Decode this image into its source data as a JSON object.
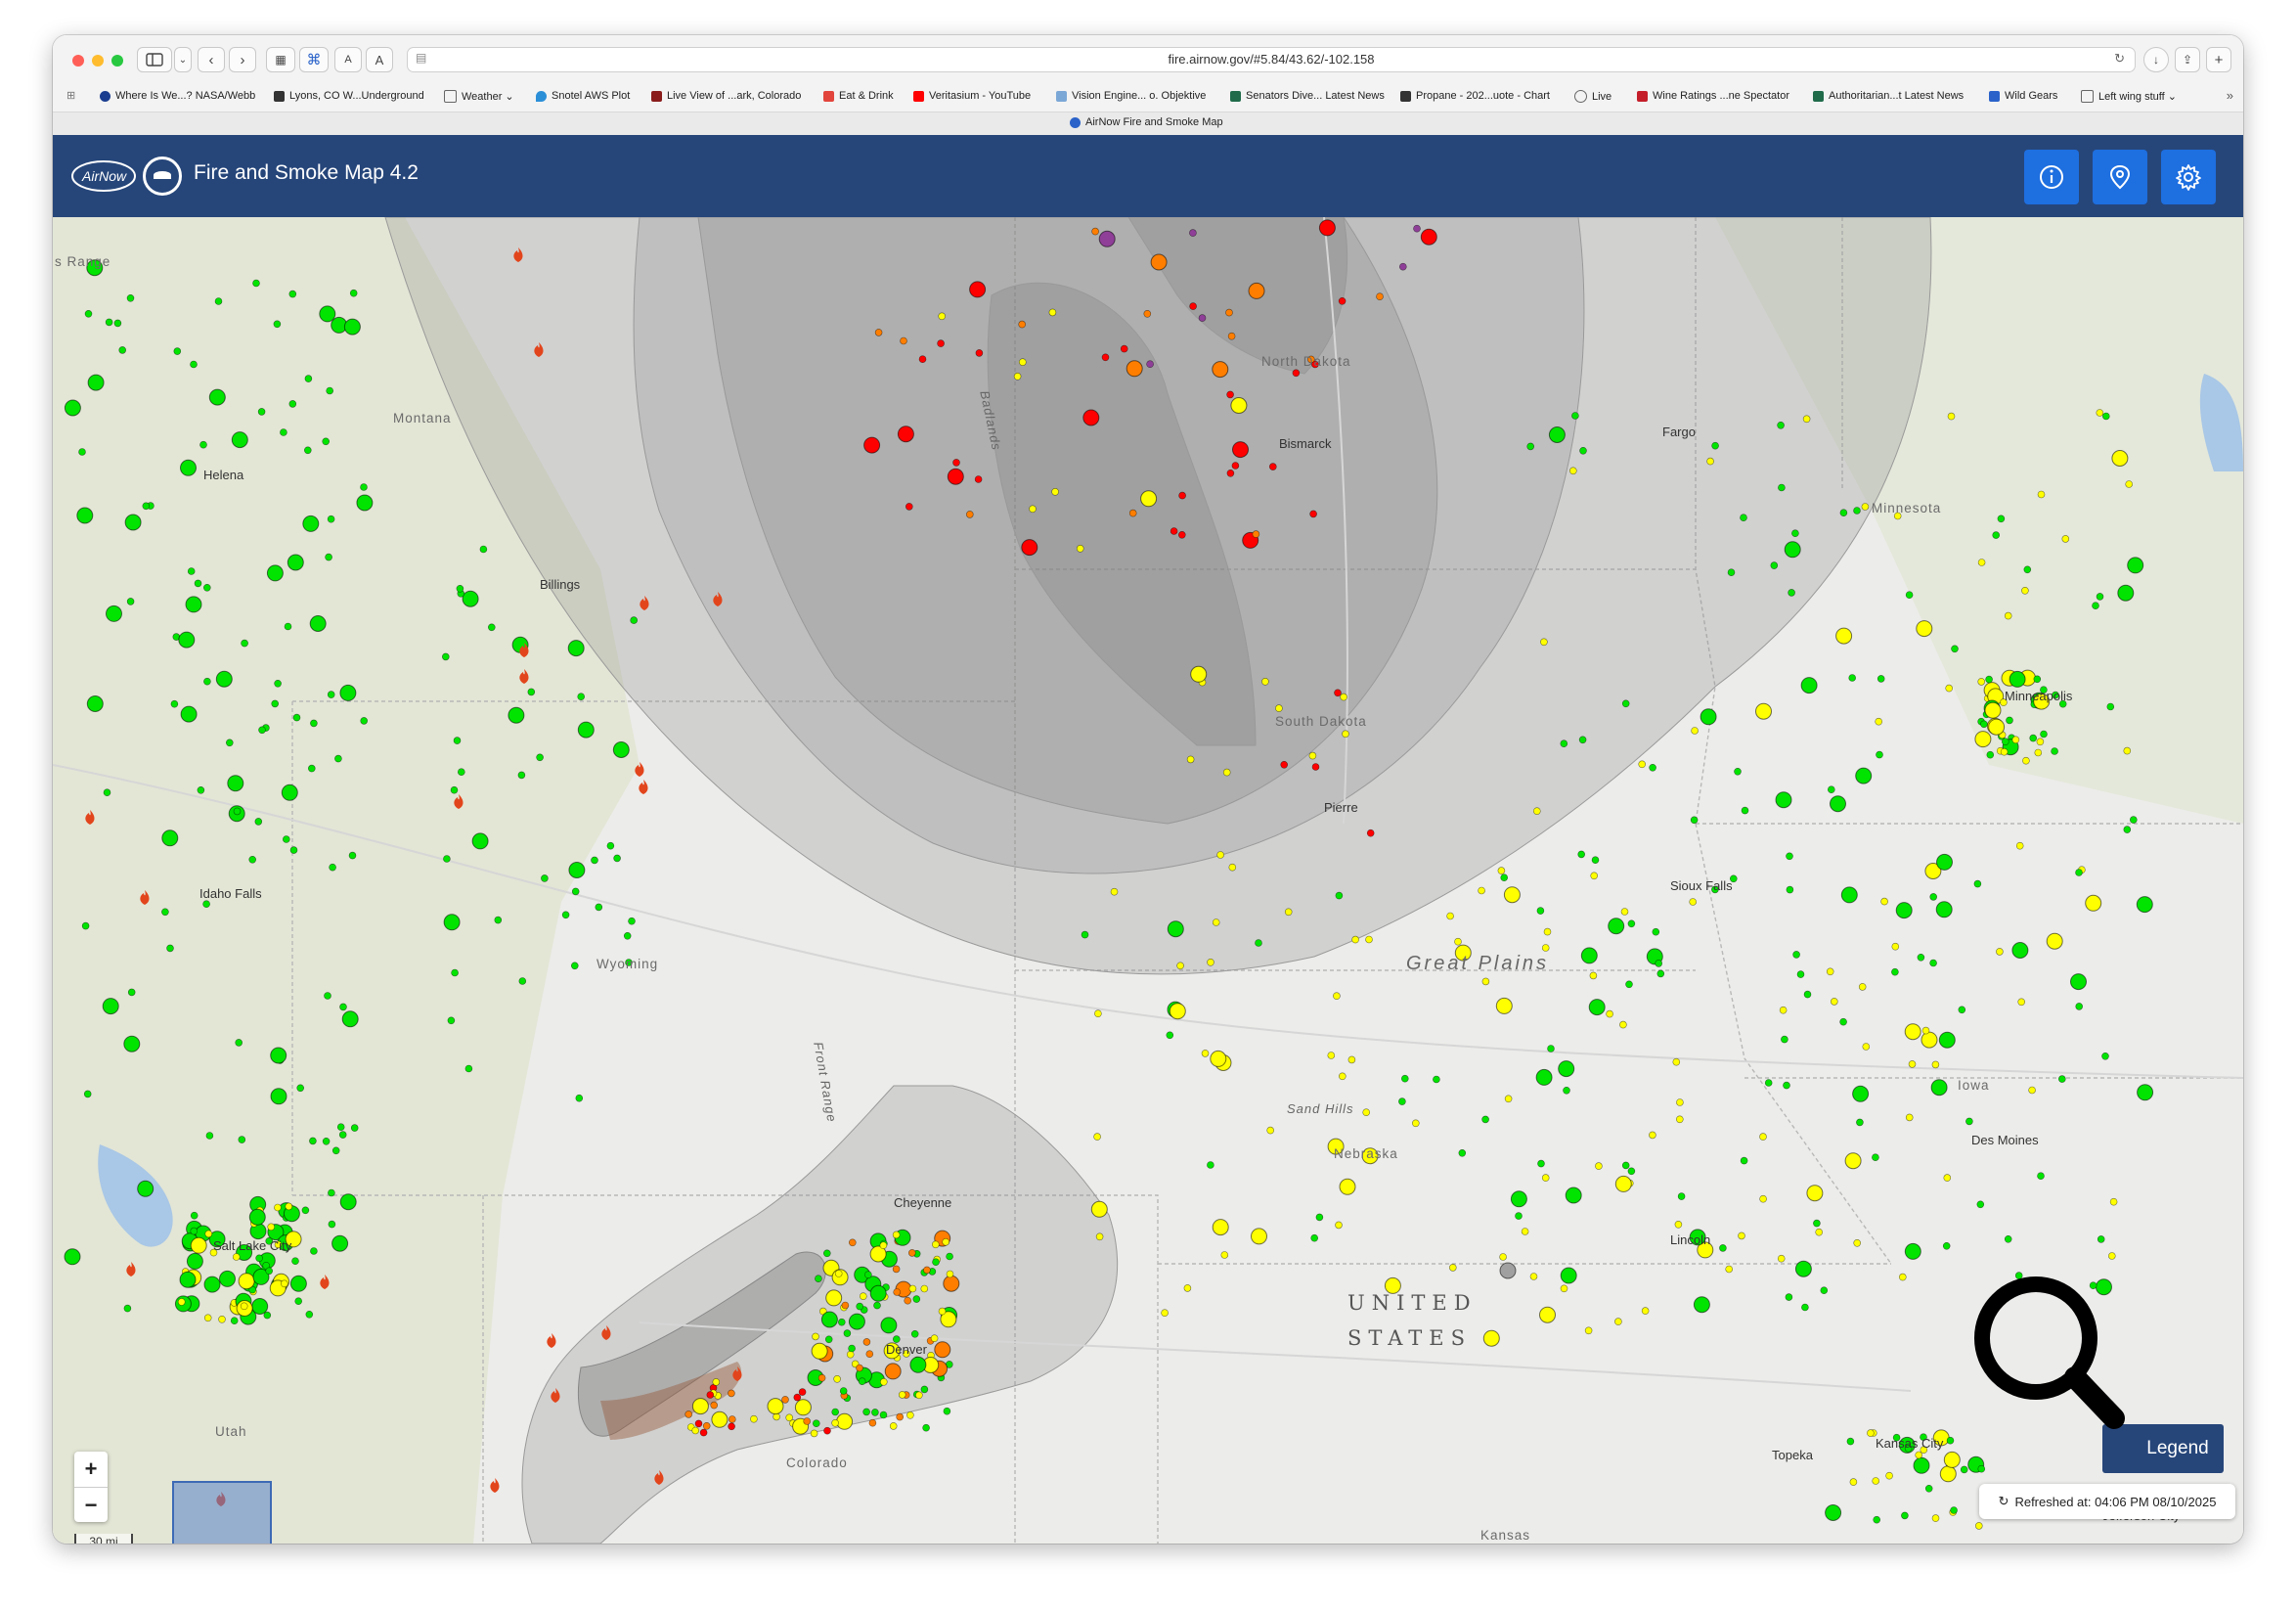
{
  "browser": {
    "url": "fire.airnow.gov/#5.84/43.62/-102.158",
    "tab_title": "AirNow Fire and Smoke Map",
    "bookmarks": [
      {
        "label": "Where Is We...? NASA/Webb"
      },
      {
        "label": "Lyons, CO W...Underground"
      },
      {
        "label": "Weather ⌄"
      },
      {
        "label": "Snotel AWS Plot"
      },
      {
        "label": "Live View of ...ark, Colorado"
      },
      {
        "label": "Eat & Drink"
      },
      {
        "label": "Veritasium - YouTube"
      },
      {
        "label": "Vision Engine... o. Objektive"
      },
      {
        "label": "Senators Dive... Latest News"
      },
      {
        "label": "Propane - 202...uote - Chart"
      },
      {
        "label": "Live"
      },
      {
        "label": "Wine Ratings ...ne Spectator"
      },
      {
        "label": "Authoritarian...t Latest News"
      },
      {
        "label": "Wild Gears"
      },
      {
        "label": "Left wing stuff ⌄"
      }
    ]
  },
  "app": {
    "logo_text": "AirNow",
    "title": "Fire and Smoke Map 4.2"
  },
  "map": {
    "labels": {
      "range": "s Range",
      "montana": "Montana",
      "helena": "Helena",
      "billings": "Billings",
      "north_dakota": "North Dakota",
      "bismarck": "Bismarck",
      "badlands": "Badlands",
      "south_dakota": "South Dakota",
      "pierre": "Pierre",
      "fargo": "Fargo",
      "minnesota": "Minnesota",
      "minneapolis": "Minneapolis",
      "idaho_falls": "Idaho Falls",
      "wyoming": "Wyoming",
      "front_range": "Front Range",
      "sioux_falls": "Sioux Falls",
      "great_plains": "Great Plains",
      "sand_hills": "Sand Hills",
      "nebraska": "Nebraska",
      "iowa": "Iowa",
      "des_moines": "Des Moines",
      "cheyenne": "Cheyenne",
      "salt_lake_city": "Salt Lake City",
      "lincoln": "Lincoln",
      "united": "UNITED",
      "states": "STATES",
      "denver": "Denver",
      "utah": "Utah",
      "colorado": "Colorado",
      "topeka": "Topeka",
      "kansas_city": "Kansas City",
      "kansas": "Kansas",
      "jefferson_city": "Jefferson City"
    },
    "scale": "30 mi",
    "zoom_in": "+",
    "zoom_out": "−"
  },
  "controls": {
    "legend_label": "Legend",
    "refreshed": "Refreshed at: 04:06 PM 08/10/2025",
    "info_icon": "i"
  },
  "colors": {
    "header": "#26467a",
    "header_button": "#1e6fe0",
    "aqi_good": "#00e400",
    "aqi_moderate": "#ffff00",
    "aqi_usg": "#ff7e00",
    "aqi_unhealthy": "#ff0000",
    "aqi_very_unhealthy": "#8f3f97",
    "smoke": "#9a9a9a"
  }
}
